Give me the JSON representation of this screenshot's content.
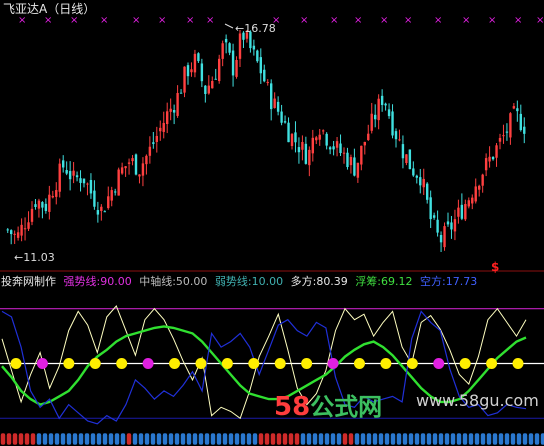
{
  "title": "飞亚达A（日线）",
  "high_label": "16.78",
  "low_label": "11.03",
  "signal_mark": "$",
  "indicator": {
    "author": "投奔网制作",
    "strong": "强势线:90.00",
    "mid": "中轴线:50.00",
    "weak": "弱势线:10.00",
    "duo": "多方:80.39",
    "fu": "浮筹:69.12",
    "kong": "空方:17.73"
  },
  "watermark": {
    "main": "58",
    "cn": "公式网",
    "url": "www.58gu.com"
  },
  "colors": {
    "up": "#ff4040",
    "down": "#40e0e0",
    "strong_line": "#c020c0",
    "mid_line": "#ffffff",
    "weak_line": "#1a1aa8",
    "duo": "#ffffc0",
    "fu": "#30e030",
    "kong": "#2030d8",
    "marker_yellow": "#ffee00",
    "marker_magenta": "#e020e0",
    "text_magenta": "#e030e0",
    "text_grey": "#bbbbbb",
    "text_cyan": "#40b0b0",
    "text_white": "#e8e8e8",
    "text_green": "#40e040",
    "text_blue": "#4060ff"
  },
  "chart_data": [
    {
      "type": "candlestick",
      "title": "飞亚达A（日线）",
      "price_range": [
        11.03,
        16.78
      ],
      "annotations": [
        {
          "label": "16.78",
          "kind": "high"
        },
        {
          "label": "11.03",
          "kind": "low"
        }
      ],
      "close_profile": [
        11.6,
        11.4,
        11.9,
        12.4,
        12.2,
        12.8,
        13.3,
        12.9,
        13.0,
        12.5,
        12.1,
        12.6,
        13.1,
        13.4,
        13.2,
        13.6,
        14.1,
        14.6,
        15.0,
        15.7,
        16.0,
        15.2,
        15.6,
        16.4,
        15.8,
        16.7,
        16.2,
        15.7,
        15.0,
        14.6,
        14.1,
        13.8,
        13.5,
        14.4,
        14.0,
        13.7,
        13.5,
        13.2,
        13.9,
        14.5,
        15.1,
        14.3,
        13.7,
        13.2,
        13.0,
        11.9,
        11.3,
        11.6,
        12.0,
        12.4,
        12.9,
        13.3,
        13.7,
        14.1,
        14.6,
        14.3
      ]
    },
    {
      "type": "line",
      "reference_lines": [
        {
          "name": "强势线",
          "value": 90
        },
        {
          "name": "中轴线",
          "value": 50
        },
        {
          "name": "弱势线",
          "value": 10
        }
      ],
      "ylim": [
        0,
        100
      ],
      "series": [
        {
          "name": "多方",
          "last": 80.39,
          "values": [
            68,
            45,
            22,
            42,
            58,
            32,
            48,
            74,
            88,
            78,
            58,
            84,
            92,
            74,
            56,
            82,
            90,
            82,
            68,
            52,
            38,
            54,
            12,
            18,
            15,
            10,
            30,
            55,
            70,
            86,
            60,
            32,
            20,
            28,
            45,
            74,
            90,
            82,
            86,
            70,
            80,
            88,
            62,
            50,
            80,
            85,
            75,
            60,
            42,
            35,
            55,
            82,
            90,
            80,
            70,
            82
          ]
        },
        {
          "name": "浮筹",
          "last": 69.12,
          "values": [
            48,
            40,
            30,
            24,
            20,
            22,
            26,
            30,
            38,
            48,
            55,
            60,
            66,
            70,
            72,
            74,
            76,
            77,
            76,
            74,
            72,
            66,
            58,
            50,
            42,
            34,
            28,
            26,
            24,
            24,
            26,
            30,
            34,
            38,
            42,
            48,
            55,
            60,
            64,
            66,
            62,
            56,
            48,
            40,
            32,
            26,
            22,
            22,
            24,
            30,
            38,
            46,
            54,
            60,
            66,
            69
          ]
        },
        {
          "name": "空方",
          "last": 17.73,
          "values": [
            88,
            84,
            62,
            30,
            18,
            24,
            10,
            20,
            14,
            8,
            6,
            12,
            8,
            20,
            38,
            32,
            24,
            30,
            26,
            34,
            44,
            30,
            72,
            62,
            66,
            72,
            62,
            42,
            60,
            78,
            82,
            74,
            70,
            80,
            76,
            40,
            20,
            18,
            26,
            22,
            24,
            26,
            22,
            68,
            88,
            80,
            74,
            46,
            26,
            18,
            20,
            12,
            14,
            20,
            18,
            17
          ]
        }
      ],
      "markers": [
        {
          "color": "yellow"
        },
        {
          "color": "magenta"
        },
        {
          "color": "yellow"
        },
        {
          "color": "yellow"
        },
        {
          "color": "yellow"
        },
        {
          "color": "magenta"
        },
        {
          "color": "yellow"
        },
        {
          "color": "yellow"
        },
        {
          "color": "yellow"
        },
        {
          "color": "yellow"
        },
        {
          "color": "yellow"
        },
        {
          "color": "yellow"
        },
        {
          "color": "magenta"
        },
        {
          "color": "yellow"
        },
        {
          "color": "yellow"
        },
        {
          "color": "yellow"
        },
        {
          "color": "magenta"
        },
        {
          "color": "yellow"
        },
        {
          "color": "yellow"
        },
        {
          "color": "yellow"
        }
      ]
    }
  ]
}
